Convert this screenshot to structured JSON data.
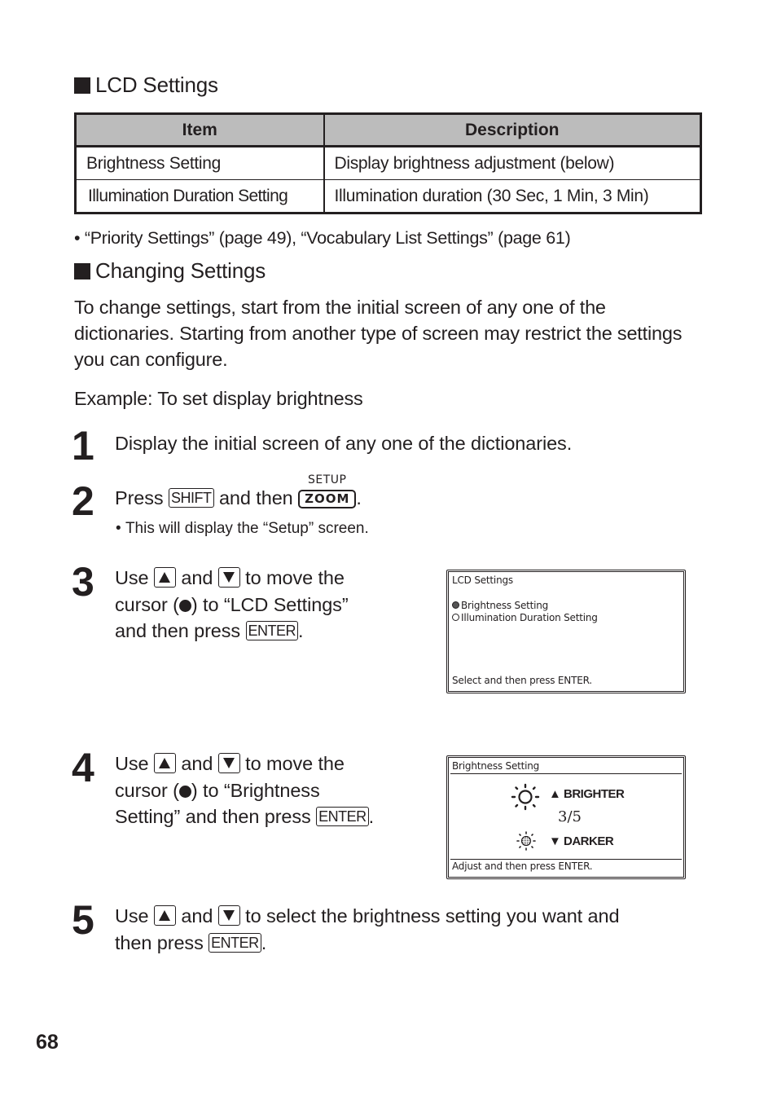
{
  "lcd_settings": {
    "heading": "LCD Settings",
    "table": {
      "headers": [
        "Item",
        "Description"
      ],
      "rows": [
        [
          "Brightness Setting",
          "Display brightness adjustment (below)"
        ],
        [
          "Illumination Duration Setting",
          "Illumination duration (30 Sec, 1 Min, 3 Min)"
        ]
      ]
    },
    "note": "“Priority Settings” (page 49), “Vocabulary List Settings” (page 61)"
  },
  "changing_settings": {
    "heading": "Changing Settings",
    "intro": "To change settings, start from the initial screen of any one of the dictionaries. Starting from another type of screen may restrict the settings you can configure.",
    "example": "Example: To set display brightness"
  },
  "keys": {
    "shift": "SHIFT",
    "zoom": "ZOOM",
    "setup": "SETUP",
    "enter": "ENTER",
    "up": "up-arrow-key",
    "down": "down-arrow-key"
  },
  "steps": [
    {
      "number": "1",
      "text": "Display the initial screen of any one of the dictionaries."
    },
    {
      "number": "2",
      "text_a": "Press",
      "text_b": "and then",
      "text_c": ".",
      "sub": "This will display the “Setup” screen."
    },
    {
      "number": "3",
      "text_a": "Use",
      "text_b": "and",
      "text_c": "to move the",
      "line2": "cursor (",
      "line2b": ") to “LCD Settings”",
      "line3": "and then press",
      "end": "."
    },
    {
      "number": "4",
      "text_a": "Use",
      "text_b": "and",
      "text_c": "to move the",
      "line2": "cursor (",
      "line2b": ") to “Brightness",
      "line3": "Setting” and then press",
      "end": "."
    },
    {
      "number": "5",
      "text_a": "Use",
      "text_b": "and",
      "text_c": "to select the brightness setting you want and",
      "line2": "then press",
      "end": "."
    }
  ],
  "screen_lcd_settings": {
    "title": "LCD Settings",
    "options": [
      {
        "label": "Brightness Setting",
        "selected": true
      },
      {
        "label": "Illumination Duration Setting",
        "selected": false
      }
    ],
    "footer": "Select and then press ENTER."
  },
  "screen_brightness": {
    "title": "Brightness Setting",
    "brighter_label": "▲ BRIGHTER",
    "darker_label": "▼ DARKER",
    "level": "3/5",
    "level_value": 3,
    "level_max": 5,
    "footer": "Adjust and then press ENTER."
  },
  "page_number": "68"
}
